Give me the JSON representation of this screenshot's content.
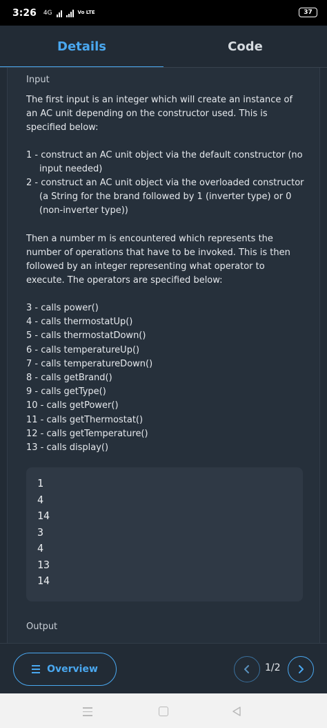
{
  "status_bar": {
    "time": "3:26",
    "network_label": "4G",
    "volte_label": "Vo LTE",
    "battery": "37"
  },
  "tabs": [
    {
      "label": "Details",
      "active": true
    },
    {
      "label": "Code",
      "active": false
    }
  ],
  "input_section": {
    "label": "Input",
    "intro": "The first input is an integer which will create an instance of an AC unit depending on the constructor used. This is specified below:",
    "constructors": [
      "1 - construct an AC unit object via the default constructor (no input needed)",
      "2 - construct an AC unit object via the overloaded constructor (a String for the brand followed by 1 (inverter type) or 0 (non-inverter type))"
    ],
    "ops_intro": "Then a number m is encountered which represents the number of operations that have to be invoked. This is then followed by an integer representing what operator to execute. The operators are specified below:",
    "operators": [
      "3 - calls power()",
      "4 - calls thermostatUp()",
      "5 - calls thermostatDown()",
      "6 - calls temperatureUp()",
      "7 - calls temperatureDown()",
      "8 - calls getBrand()",
      "9 - calls getType()",
      "10 - calls getPower()",
      "11 - calls getThermostat()",
      "12 - calls getTemperature()",
      "13 - calls display()"
    ],
    "sample_input": [
      "1",
      "4",
      "14",
      "3",
      "4",
      "13",
      "14"
    ]
  },
  "output_section": {
    "label": "Output"
  },
  "bottom_bar": {
    "overview_label": "Overview",
    "page_indicator": "1/2"
  },
  "colors": {
    "accent": "#4aa8f0",
    "background": "#222b35",
    "panel": "#26303b",
    "code_box": "#2f3945"
  }
}
